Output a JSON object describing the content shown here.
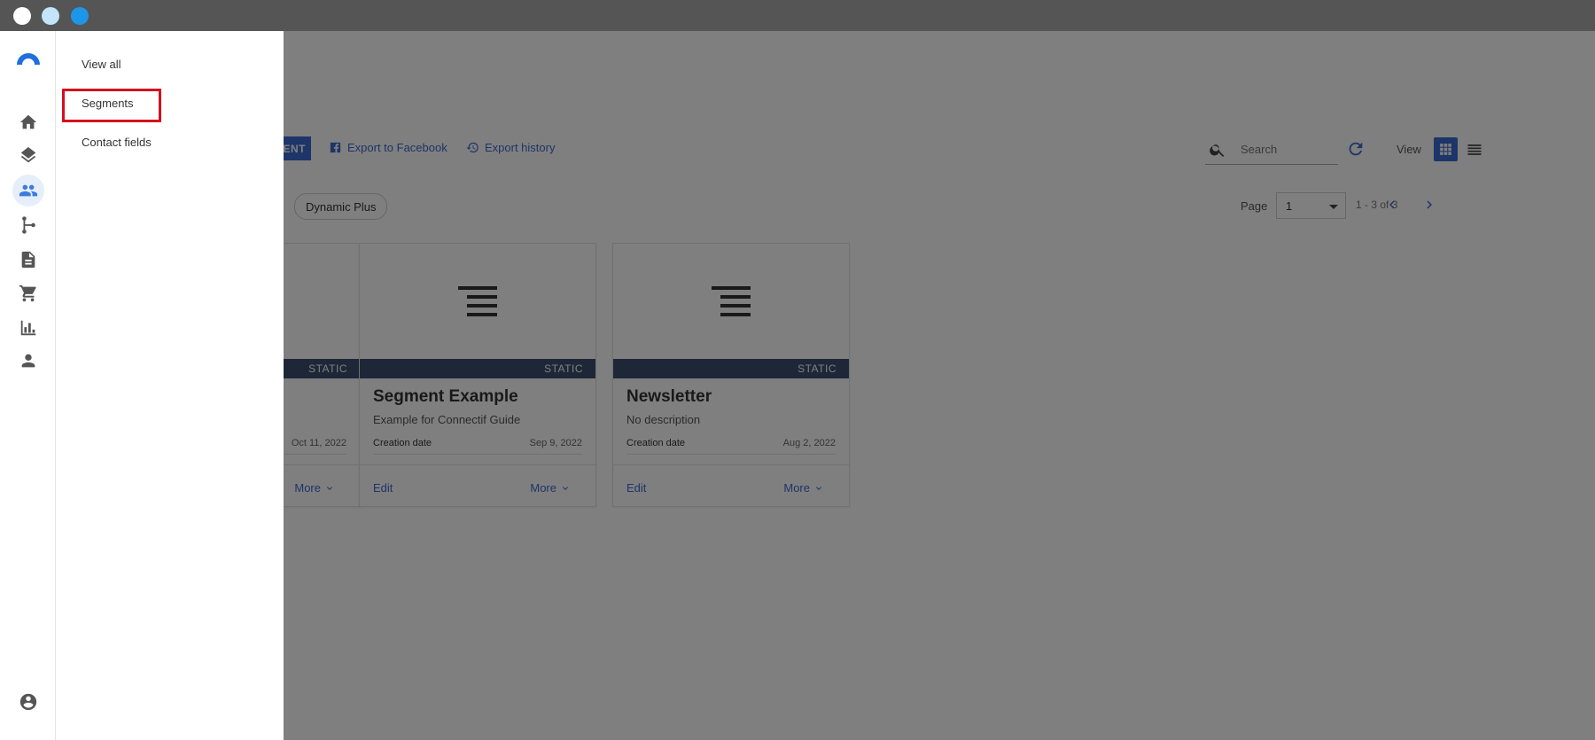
{
  "window": {
    "traffic_lights": [
      {
        "name": "close",
        "color": "#ffffff"
      },
      {
        "name": "minimize",
        "color": "#c3e4f9"
      },
      {
        "name": "maximize",
        "color": "#1e96e8"
      }
    ]
  },
  "nav_rail": {
    "logo_icon": "connectif-logo",
    "items": [
      {
        "icon": "home-icon",
        "active": false
      },
      {
        "icon": "layers-icon",
        "active": false
      },
      {
        "icon": "contacts-icon",
        "active": true
      },
      {
        "icon": "workflow-icon",
        "active": false
      },
      {
        "icon": "document-icon",
        "active": false
      },
      {
        "icon": "cart-icon",
        "active": false
      },
      {
        "icon": "bar-chart-icon",
        "active": false
      },
      {
        "icon": "person-icon",
        "active": false
      }
    ],
    "bottom_icon": "account-circle-icon"
  },
  "submenu": {
    "items": [
      {
        "label": "View all"
      },
      {
        "label": "Segments",
        "highlighted": true
      },
      {
        "label": "Contact fields"
      }
    ]
  },
  "toolbar": {
    "new_button_label": "ENT",
    "export_facebook_label": "Export to Facebook",
    "export_history_label": "Export history",
    "search_placeholder": "Search",
    "view_label": "View"
  },
  "filters": {
    "chip_label": "Dynamic Plus"
  },
  "pagination": {
    "page_label": "Page",
    "current_page": "1",
    "range_text": "1 - 3 of 3"
  },
  "cards": [
    {
      "type": "STATIC",
      "title": "",
      "description": "",
      "meta_label": "",
      "meta_value": "Oct 11, 2022",
      "edit_label": "",
      "more_label": "More"
    },
    {
      "type": "STATIC",
      "title": "Segment Example",
      "description": "Example for Connectif Guide",
      "meta_label": "Creation date",
      "meta_value": "Sep 9, 2022",
      "edit_label": "Edit",
      "more_label": "More"
    },
    {
      "type": "STATIC",
      "title": "Newsletter",
      "description": "No description",
      "meta_label": "Creation date",
      "meta_value": "Aug 2, 2022",
      "edit_label": "Edit",
      "more_label": "More"
    }
  ],
  "colors": {
    "accent": "#3a6bd1",
    "card_band": "#3a4f70",
    "highlight": "#d40f1c",
    "overlay": "rgba(0,0,0,0.5)"
  }
}
